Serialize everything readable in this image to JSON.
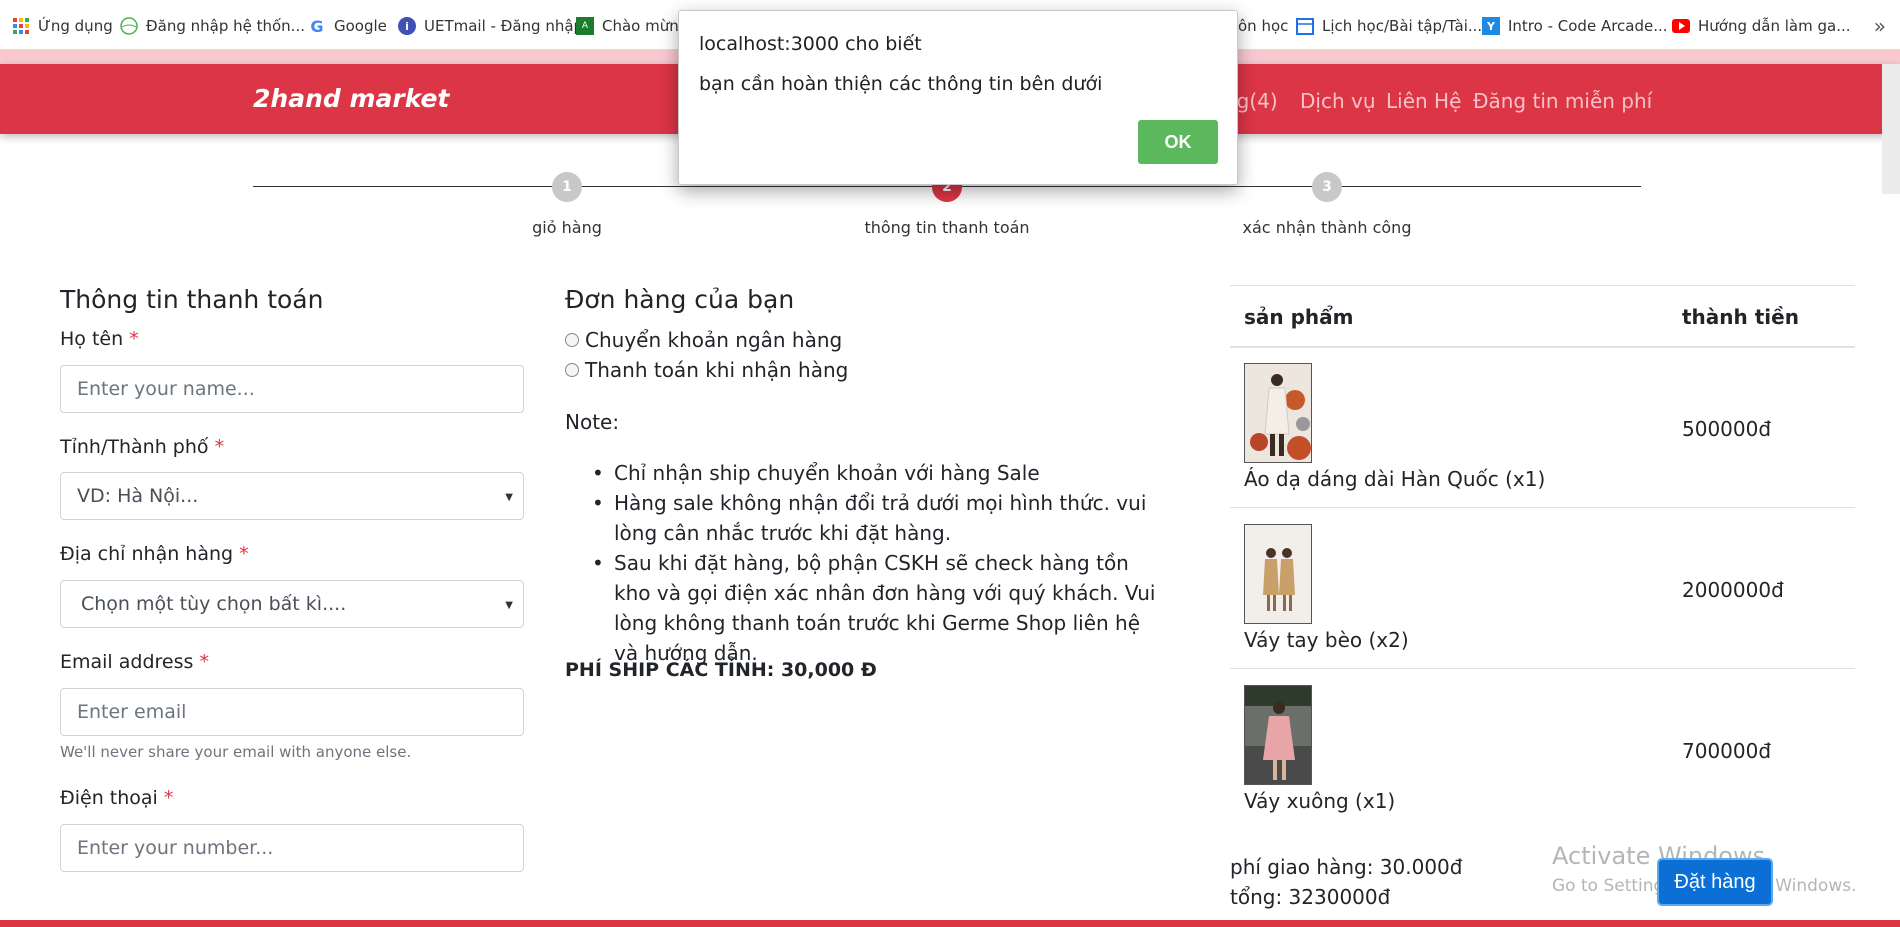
{
  "bookmarks": [
    {
      "label": "Ứng dụng",
      "icon": "apps-grid-icon"
    },
    {
      "label": "Đăng nhập hệ thốn...",
      "icon": "globe-icon"
    },
    {
      "label": "Google",
      "icon": "google-icon"
    },
    {
      "label": "UETmail - Đăng nhập",
      "icon": "info-icon"
    },
    {
      "label": "Chào mừng",
      "icon": "green-badge-icon"
    },
    {
      "label": "ôn học",
      "icon": ""
    },
    {
      "label": "Lịch học/Bài tập/Tài...",
      "icon": "calendar-icon"
    },
    {
      "label": "Intro - Code Arcade...",
      "icon": "arcade-icon"
    },
    {
      "label": "Hướng dẫn làm ga...",
      "icon": "youtube-icon"
    }
  ],
  "bookmarks_more": "»",
  "navbar": {
    "brand": "2hand market",
    "items": [
      "ng(4)",
      "Dịch vụ",
      "Liên Hệ",
      "Đăng tin miễn phí"
    ]
  },
  "stepper": [
    {
      "num": "1",
      "label": "giỏ hàng"
    },
    {
      "num": "2",
      "label": "thông tin thanh toán"
    },
    {
      "num": "3",
      "label": "xác nhận thành công"
    }
  ],
  "form": {
    "title": "Thông tin thanh toán",
    "required_mark": "*",
    "name_label": "Họ tên",
    "name_placeholder": "Enter your name...",
    "city_label": "Tỉnh/Thành phố",
    "city_value": "VD: Hà Nội...",
    "address_label": "Địa chỉ nhận hàng",
    "address_value": "Chọn một tùy chọn bất kì....",
    "email_label": "Email address",
    "email_placeholder": "Enter email",
    "email_help": "We'll never share your email with anyone else.",
    "phone_label": "Điện thoại",
    "phone_placeholder": "Enter your number..."
  },
  "order": {
    "title": "Đơn hàng của bạn",
    "payment_options": [
      "Chuyển khoản ngân hàng",
      "Thanh toán khi nhận hàng"
    ],
    "note_label": "Note:",
    "notes": [
      "Chỉ nhận ship chuyển khoản với hàng Sale",
      "Hàng sale không nhận đổi trả dưới mọi hình thức. vui lòng cân nhắc trước khi đặt hàng.",
      "Sau khi đặt hàng, bộ phận CSKH sẽ check hàng tồn kho và gọi điện xác nhân đơn hàng với quý khách. Vui lòng không thanh toán trước khi Germe Shop liên hệ và hướng dẫn."
    ],
    "shipping_note": "PHÍ SHIP CÁC TỈNH: 30,000 Đ"
  },
  "cart": {
    "col_product": "sản phẩm",
    "col_total": "thành tiền",
    "items": [
      {
        "name": "Áo dạ dáng dài Hàn Quốc (x1)",
        "price": "500000đ"
      },
      {
        "name": "Váy tay bèo (x2)",
        "price": "2000000đ"
      },
      {
        "name": "Váy xuông (x1)",
        "price": "700000đ"
      }
    ],
    "shipping_fee": "phí giao hàng: 30.000đ",
    "total": "tổng: 3230000đ",
    "order_button": "Đặt hàng"
  },
  "watermark": {
    "line1": "Activate Windows",
    "line2": "Go to Settings to activate Windows."
  },
  "dialog": {
    "title": "localhost:3000 cho biết",
    "message": "bạn cần hoàn thiện các thông tin bên dưới",
    "ok": "OK"
  },
  "colors": {
    "brand_red": "#dc3545",
    "ok_green": "#5cb85c",
    "primary_blue": "#0b6fd6"
  }
}
